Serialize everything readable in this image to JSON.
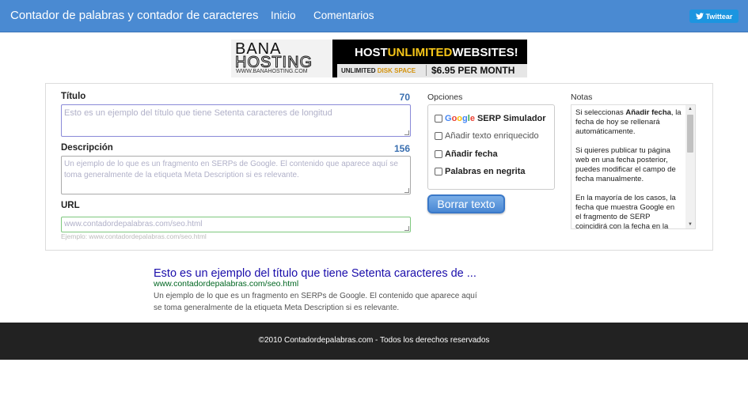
{
  "navbar": {
    "brand": "Contador de palabras y contador de caracteres",
    "links": [
      "Inicio",
      "Comentarios"
    ],
    "twitter_label": "Twittear"
  },
  "ad": {
    "logo_top": "BANA",
    "logo_bottom": "HOSTING",
    "logo_url": "WWW.BANAHOSTING.COM",
    "headline_a": "HOST",
    "headline_b": "UNLIMITED",
    "headline_c": "WEBSITES!",
    "disk_a": "UNLIMITED ",
    "disk_b": "DISK SPACE",
    "price": "$6.95 PER MONTH"
  },
  "form": {
    "title_label": "Título",
    "title_counter": "70",
    "title_placeholder": "Esto es un ejemplo del título que tiene Setenta caracteres de longitud",
    "desc_label": "Descripción",
    "desc_counter": "156",
    "desc_placeholder": "Un ejemplo de lo que es un fragmento en SERPs de Google. El contenido que aparece aquí se toma generalmente de la etiqueta Meta Description si es relevante.",
    "url_label": "URL",
    "url_placeholder": "www.contadordepalabras.com/seo.html",
    "url_hint": "Ejemplo:  www.contadordepalabras.com/seo.html"
  },
  "options": {
    "label": "Opciones",
    "google_word": [
      "G",
      "o",
      "o",
      "g",
      "l",
      "e"
    ],
    "serp_label": " SERP Simulador",
    "rich_text": "Añadir texto enriquecido",
    "add_date": "Añadir fecha",
    "bold_words": "Palabras en negrita",
    "clear_button": "Borrar texto"
  },
  "notes": {
    "label": "Notas",
    "p1_a": "Si seleccionas ",
    "p1_b": "Añadir fecha",
    "p1_c": ", la fecha de hoy se rellenará automáticamente.",
    "p2": "Si quieres publicar tu página web en una fecha posterior, puedes modificar el campo de fecha manualmente.",
    "p3": "En la mayoría de los casos, la fecha que muestra Google en el fragmento de SERP coincidirá con la fecha en la"
  },
  "serp": {
    "title": "Esto es un ejemplo del título que tiene Setenta caracteres de ...",
    "url": "www.contadordepalabras.com/seo.html",
    "description": "Un ejemplo de lo que es un fragmento en SERPs de Google. El contenido que aparece aquí se toma generalmente de la etiqueta Meta Description si es relevante."
  },
  "footer": {
    "text": "©2010 Contadordepalabras.com - Todos los derechos reservados"
  },
  "colors": {
    "navbar": "#4a8ad2",
    "counter": "#3a6fb0",
    "serp_title": "#1a0dab",
    "serp_url": "#006621",
    "footer": "#222222"
  }
}
